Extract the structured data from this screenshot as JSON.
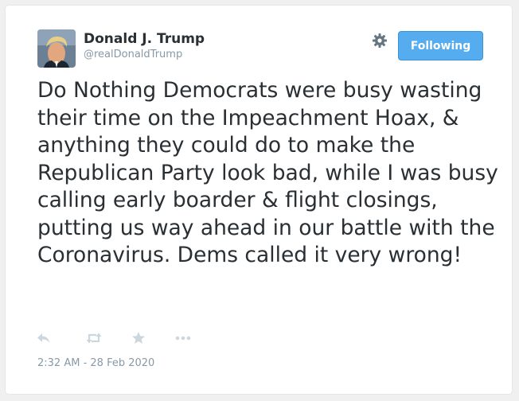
{
  "tweet": {
    "author": {
      "display_name": "Donald J. Trump",
      "handle": "@realDonaldTrump",
      "avatar_icon": "user-avatar"
    },
    "follow_button_label": "Following",
    "settings_icon": "gear-icon",
    "text": "Do Nothing Democrats were busy wasting their time on the Impeachment Hoax, & anything they could do to make the Republican Party look bad, while I was busy calling early boarder & flight closings, putting us way ahead in our battle with the Coronavirus. Dems called it very wrong!",
    "actions": [
      {
        "icon": "reply-icon"
      },
      {
        "icon": "retweet-icon"
      },
      {
        "icon": "favorite-star-icon"
      },
      {
        "icon": "more-dots-icon"
      }
    ],
    "timestamp": "2:32 AM - 28 Feb 2020"
  },
  "colors": {
    "accent": "#55acee",
    "text": "#292f33",
    "muted": "#8899a6",
    "icon": "#ccd6dd"
  }
}
